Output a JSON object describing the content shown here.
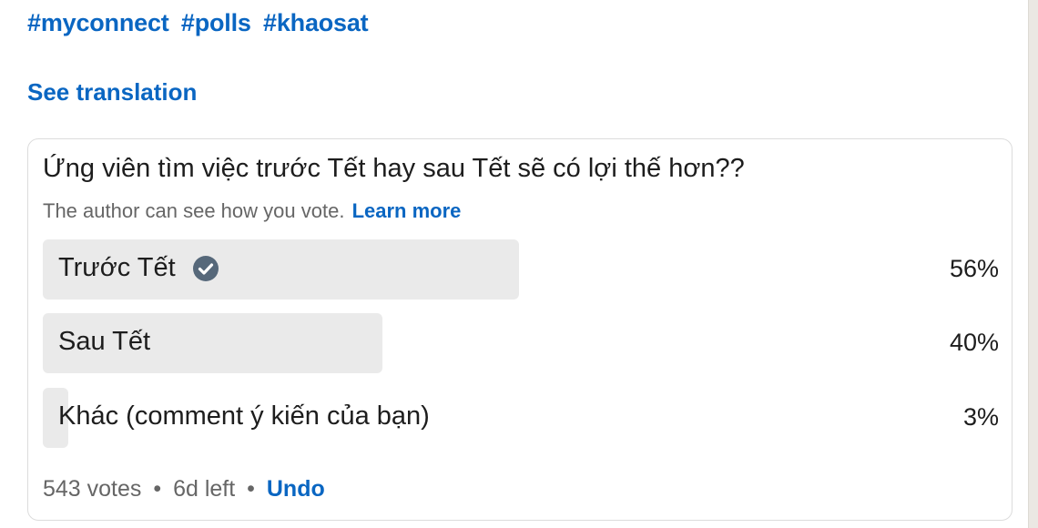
{
  "hashtags": [
    "#myconnect",
    "#polls",
    "#khaosat"
  ],
  "see_translation": "See translation",
  "poll": {
    "question": "Ứng viên tìm việc trước Tết hay sau Tết sẽ có lợi thế hơn??",
    "note": "The author can see how you vote.",
    "learn_more": "Learn more",
    "options": [
      {
        "label": "Trước Tết",
        "percent_text": "56%",
        "percent": 56,
        "selected": true
      },
      {
        "label": "Sau Tết",
        "percent_text": "40%",
        "percent": 40,
        "selected": false
      },
      {
        "label": "Khác (comment ý kiến của bạn)",
        "percent_text": "3%",
        "percent": 3,
        "selected": false
      }
    ],
    "votes": "543 votes",
    "time_left": "6d left",
    "separator": "•",
    "undo": "Undo"
  },
  "colors": {
    "link": "#0a66c2",
    "bar": "#eaeaea",
    "check": "#56687a"
  }
}
